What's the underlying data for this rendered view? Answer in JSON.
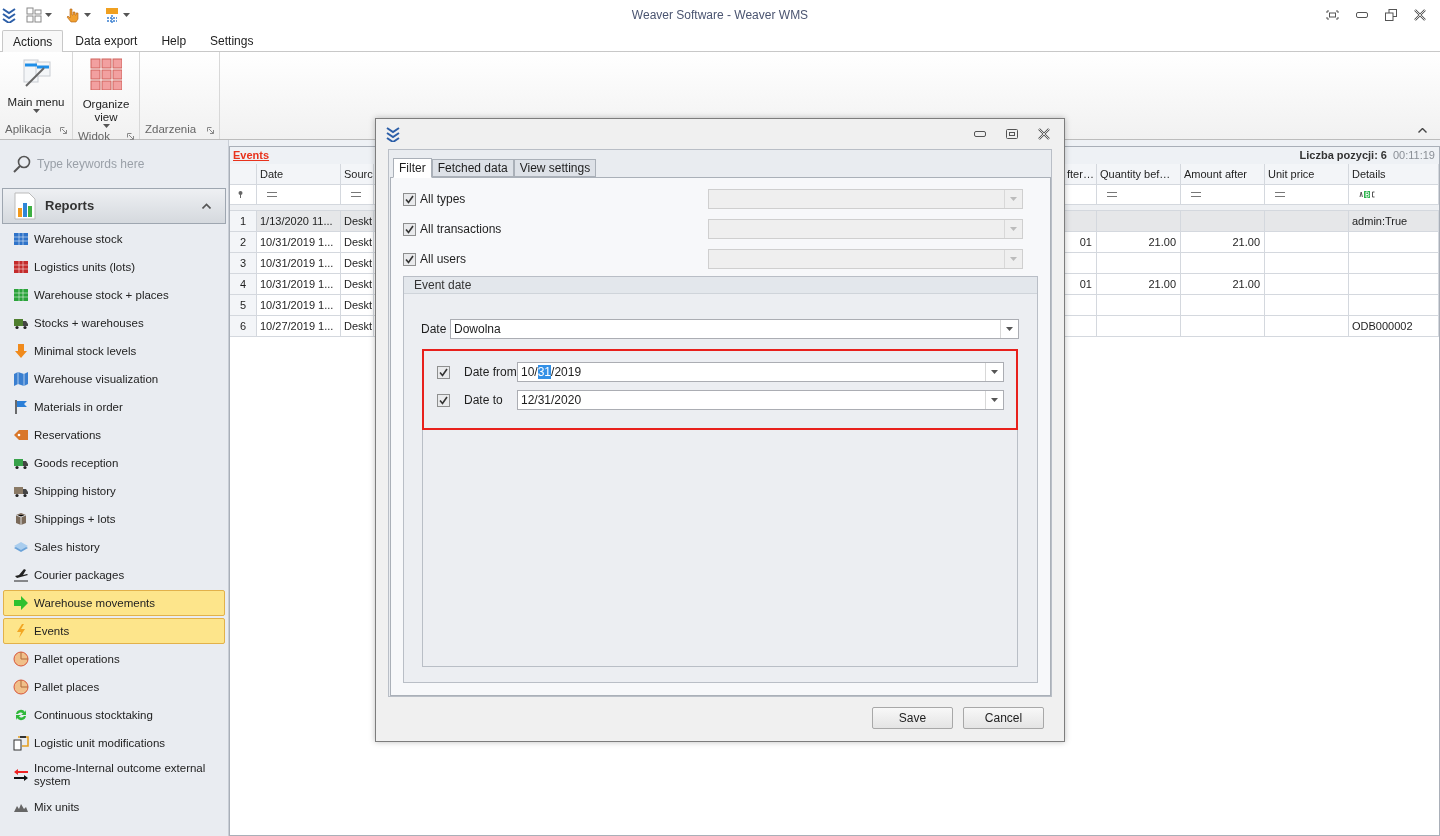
{
  "app": {
    "title": "Weaver Software - Weaver WMS"
  },
  "ribbon": {
    "tabs": [
      {
        "label": "Actions",
        "selected": true
      },
      {
        "label": "Data export",
        "selected": false
      },
      {
        "label": "Help",
        "selected": false
      },
      {
        "label": "Settings",
        "selected": false
      }
    ],
    "groups": [
      {
        "label": "Aplikacja",
        "buttons": [
          {
            "label": "Main menu",
            "kind": "menu",
            "dropdown": true
          }
        ]
      },
      {
        "label": "Widok",
        "buttons": [
          {
            "label": "Organize view",
            "kind": "grid",
            "dropdown": true
          }
        ]
      },
      {
        "label": "Zdarzenia"
      }
    ]
  },
  "sidebar": {
    "search": {
      "placeholder": "Type keywords here"
    },
    "section": {
      "label": "Reports",
      "expanded": true
    },
    "items": [
      {
        "label": "Warehouse stock",
        "selected": false
      },
      {
        "label": "Logistics units (lots)",
        "selected": false
      },
      {
        "label": "Warehouse stock + places",
        "selected": false
      },
      {
        "label": "Stocks + warehouses",
        "selected": false
      },
      {
        "label": "Minimal stock levels",
        "selected": false
      },
      {
        "label": "Warehouse visualization",
        "selected": false
      },
      {
        "label": "Materials in order",
        "selected": false
      },
      {
        "label": "Reservations",
        "selected": false
      },
      {
        "label": "Goods reception",
        "selected": false
      },
      {
        "label": "Shipping history",
        "selected": false
      },
      {
        "label": "Shippings + lots",
        "selected": false
      },
      {
        "label": "Sales history",
        "selected": false
      },
      {
        "label": "Courier packages",
        "selected": false
      },
      {
        "label": "Warehouse movements",
        "selected": true
      },
      {
        "label": "Events",
        "selected": true
      },
      {
        "label": "Pallet operations",
        "selected": false
      },
      {
        "label": "Pallet places",
        "selected": false
      },
      {
        "label": "Continuous stocktaking",
        "selected": false
      },
      {
        "label": "Logistic unit modifications",
        "selected": false
      },
      {
        "label": "Income-Internal outcome external system",
        "selected": false
      },
      {
        "label": "Mix units",
        "selected": false
      }
    ]
  },
  "grid": {
    "title": "Events",
    "count": "Liczba pozycji: 6",
    "time": "00:11:19",
    "columns": [
      {
        "label": "Date",
        "kind": "text",
        "filter": {
          "kind": "equals"
        }
      },
      {
        "label": "Sourc",
        "kind": "text",
        "filter": {
          "kind": "equals"
        }
      },
      {
        "label": "fter…",
        "kind": "number"
      },
      {
        "label": "Quantity bef…",
        "kind": "number",
        "filter": {
          "kind": "equals"
        }
      },
      {
        "label": "Amount after",
        "kind": "number",
        "filter": {
          "kind": "equals"
        }
      },
      {
        "label": "Unit price",
        "kind": "number",
        "filter": {
          "kind": "equals"
        }
      },
      {
        "label": "Details",
        "kind": "text",
        "filter": {
          "kind": "abc"
        }
      }
    ],
    "rows": [
      {
        "number": "1",
        "selected": true,
        "date": "1/13/2020 11...",
        "source": "Deskt",
        "details": "admin:True"
      },
      {
        "number": "2",
        "selected": false,
        "date": "10/31/2019 1...",
        "source": "Deskt",
        "column_3": "01",
        "quantity_before": "21.00",
        "amount_after": "21.00"
      },
      {
        "number": "3",
        "selected": false,
        "date": "10/31/2019 1...",
        "source": "Deskt"
      },
      {
        "number": "4",
        "selected": false,
        "date": "10/31/2019 1...",
        "source": "Deskt",
        "column_3": "01",
        "quantity_before": "21.00",
        "amount_after": "21.00"
      },
      {
        "number": "5",
        "selected": false,
        "date": "10/31/2019 1...",
        "source": "Deskt"
      },
      {
        "number": "6",
        "selected": false,
        "date": "10/27/2019 1...",
        "source": "Deskt",
        "details": "ODB000002"
      }
    ]
  },
  "dialog": {
    "tabs": [
      {
        "label": "Filter",
        "selected": true
      },
      {
        "label": "Fetched data",
        "selected": false
      },
      {
        "label": "View settings",
        "selected": false
      }
    ],
    "filters": [
      {
        "label": "All types",
        "checked": true,
        "combo_disabled": true
      },
      {
        "label": "All transactions",
        "checked": true,
        "combo_disabled": true
      },
      {
        "label": "All users",
        "checked": true,
        "combo_disabled": true
      }
    ],
    "event_date": {
      "title": "Event date",
      "date_label": "Date",
      "date_value": "Dowolna",
      "range_highlighted": true,
      "range": [
        {
          "label": "Date from",
          "checked": true,
          "value_parts": [
            {
              "text": "10/",
              "selected": false
            },
            {
              "text": "31",
              "selected": true
            },
            {
              "text": "/2019",
              "selected": false
            }
          ]
        },
        {
          "label": "Date to",
          "checked": true,
          "value_parts": [
            {
              "text": "12/31/2020",
              "selected": false
            }
          ]
        }
      ]
    },
    "buttons": [
      "Save",
      "Cancel"
    ]
  }
}
